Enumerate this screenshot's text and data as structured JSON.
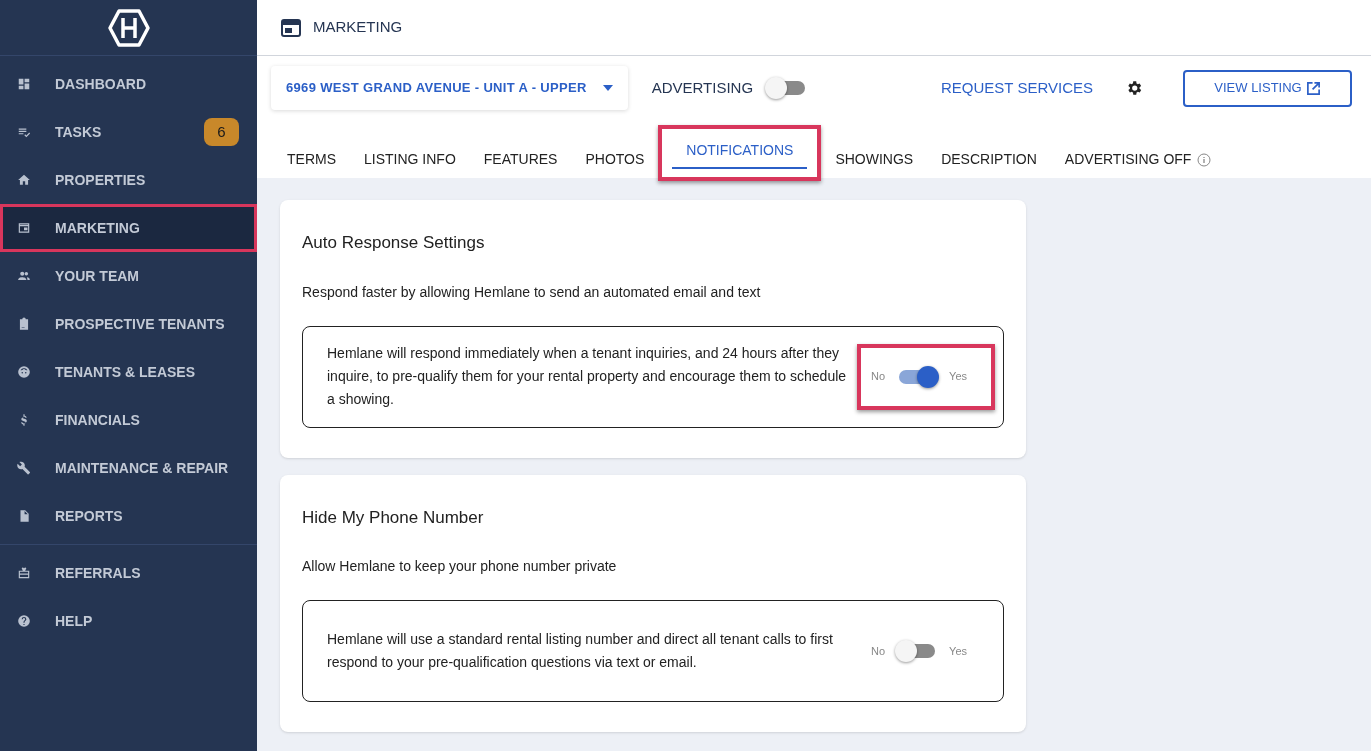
{
  "sidebar": {
    "items": [
      {
        "label": "DASHBOARD",
        "selected": false
      },
      {
        "label": "TASKS",
        "selected": false,
        "badge": "6"
      },
      {
        "label": "PROPERTIES",
        "selected": false
      },
      {
        "label": "MARKETING",
        "selected": true,
        "highlighted": true
      },
      {
        "label": "YOUR TEAM",
        "selected": false
      },
      {
        "label": "PROSPECTIVE TENANTS",
        "selected": false
      },
      {
        "label": "TENANTS & LEASES",
        "selected": false
      },
      {
        "label": "FINANCIALS",
        "selected": false
      },
      {
        "label": "MAINTENANCE & REPAIR",
        "selected": false
      },
      {
        "label": "REPORTS",
        "selected": false
      }
    ],
    "bottom_items": [
      {
        "label": "REFERRALS",
        "selected": false
      },
      {
        "label": "HELP",
        "selected": false
      }
    ]
  },
  "header": {
    "title": "MARKETING"
  },
  "toolbar": {
    "property": "6969 WEST GRAND AVENUE - UNIT A - UPPER",
    "advertising_label": "ADVERTISING",
    "advertising_on": false,
    "request_services": "REQUEST SERVICES",
    "view_listing": "VIEW LISTING"
  },
  "tabs": [
    {
      "label": "TERMS",
      "selected": false
    },
    {
      "label": "LISTING INFO",
      "selected": false
    },
    {
      "label": "FEATURES",
      "selected": false
    },
    {
      "label": "PHOTOS",
      "selected": false
    },
    {
      "label": "NOTIFICATIONS",
      "selected": true,
      "highlighted": true
    },
    {
      "label": "SHOWINGS",
      "selected": false
    },
    {
      "label": "DESCRIPTION",
      "selected": false
    },
    {
      "label": "ADVERTISING OFF",
      "selected": false,
      "info": true
    }
  ],
  "cards": [
    {
      "title": "Auto Response Settings",
      "subtitle": "Respond faster by allowing Hemlane to send an automated email and text",
      "description": "Hemlane will respond immediately when a tenant inquiries, and 24 hours after they inquire, to pre-qualify them for your rental property and encourage them to schedule a showing.",
      "no_label": "No",
      "yes_label": "Yes",
      "on": true,
      "highlighted": true
    },
    {
      "title": "Hide My Phone Number",
      "subtitle": "Allow Hemlane to keep your phone number private",
      "description": "Hemlane will use a standard rental listing number and direct all tenant calls to first respond to your pre-qualification questions via text or email.",
      "no_label": "No",
      "yes_label": "Yes",
      "on": false
    }
  ]
}
